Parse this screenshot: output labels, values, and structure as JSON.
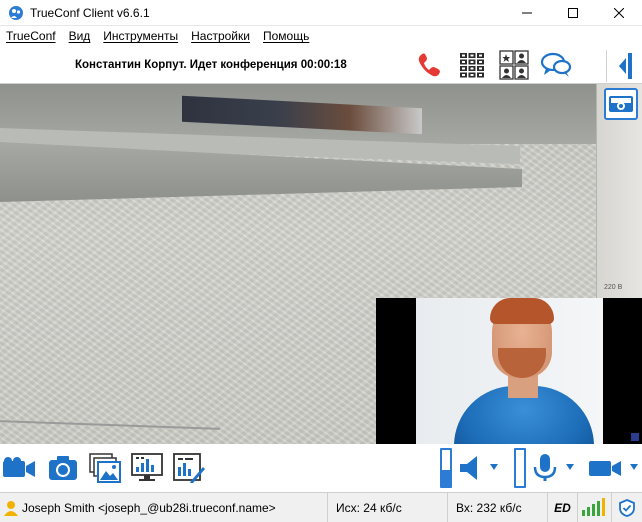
{
  "window": {
    "title": "TrueConf Client v6.6.1",
    "controls": [
      "minimize",
      "maximize",
      "close"
    ]
  },
  "menu": {
    "items": [
      "TrueConf",
      "Вид",
      "Инструменты",
      "Настройки",
      "Помощь"
    ]
  },
  "toolbar": {
    "status": "Константин Корпут.  Идет конференция 00:00:18",
    "icons": [
      "hangup-phone-icon",
      "dialpad-icon",
      "participants-icon",
      "chat-icon",
      "collapse-panel-icon"
    ]
  },
  "video": {
    "wall_label": "220 В",
    "top_right_icon": "camera-switch-icon"
  },
  "controls": {
    "icons": [
      "camera-icon",
      "snapshot-icon",
      "slideshow-icon",
      "screen-share-icon",
      "whiteboard-icon",
      "speaker-icon",
      "microphone-icon",
      "camera-select-icon"
    ],
    "speaker_level": 0.45,
    "mic_level": 0.0
  },
  "statusbar": {
    "user": "Joseph Smith <joseph_@ub28i.trueconf.name>",
    "outgoing": "Исх: 24 кб/с",
    "incoming": "Вх: 232 кб/с",
    "quality": "ED"
  },
  "colors": {
    "accent": "#2c7cd6",
    "hangup": "#e53935",
    "signal": "#3aa53a"
  }
}
